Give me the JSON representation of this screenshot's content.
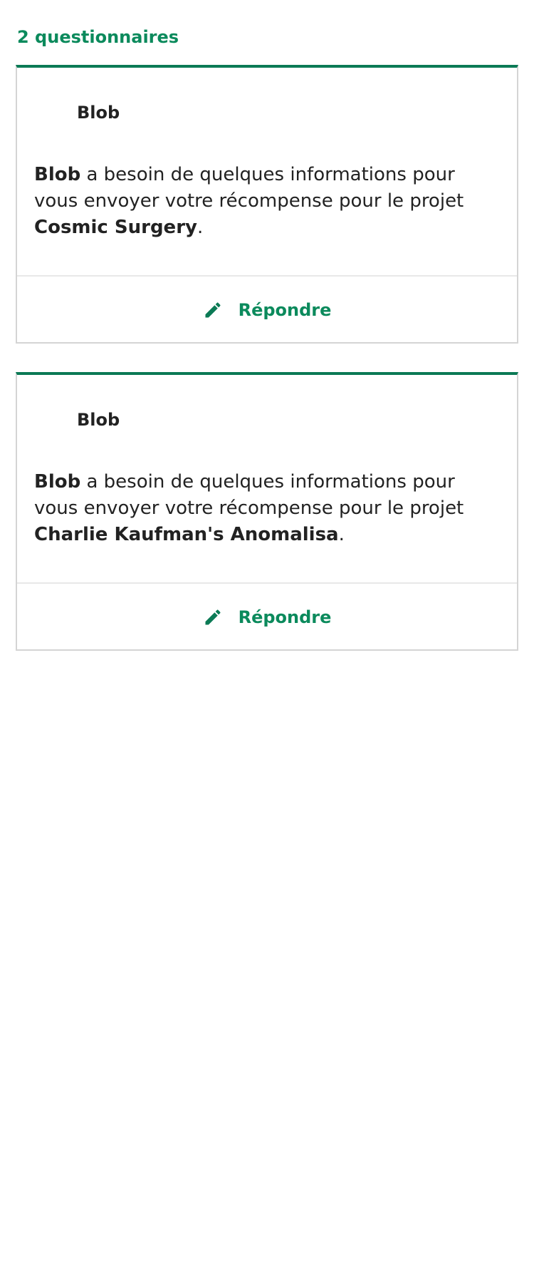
{
  "header": {
    "count_label": "2 questionnaires"
  },
  "colors": {
    "accent": "#0b8a5c",
    "card_top_border": "#0b7a55",
    "card_border": "#d4d4d4",
    "divider": "#e8e8e8",
    "text": "#222222"
  },
  "cards": [
    {
      "creator": "Blob",
      "message_creator": "Blob",
      "message_middle": " a besoin de quelques informations pour vous envoyer votre récompense pour le projet ",
      "project": "Cosmic Surgery",
      "message_end": ".",
      "button_label": "Répondre",
      "button_icon": "pencil-icon"
    },
    {
      "creator": "Blob",
      "message_creator": "Blob",
      "message_middle": " a besoin de quelques informations pour vous envoyer votre récompense pour le projet ",
      "project": "Charlie Kaufman's Anomalisa",
      "message_end": ".",
      "button_label": "Répondre",
      "button_icon": "pencil-icon"
    }
  ]
}
